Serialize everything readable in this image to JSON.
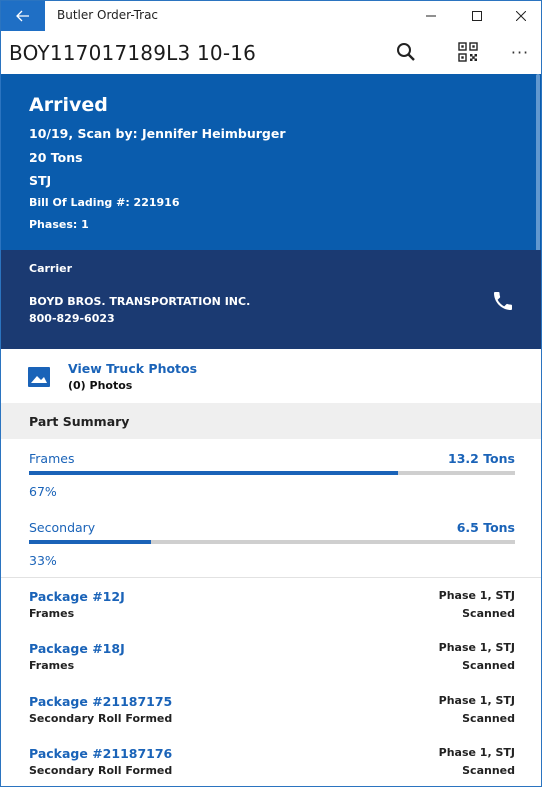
{
  "window": {
    "app_title": "Butler Order-Trac"
  },
  "header": {
    "title": "BOY117017189L3 10-16",
    "more_label": "···"
  },
  "status": {
    "state": "Arrived",
    "scan_line": "10/19, Scan by: Jennifer Heimburger",
    "weight": "20 Tons",
    "location": "STJ",
    "bill_of_lading": "Bill Of Lading #: 221916",
    "phases": "Phases: 1"
  },
  "carrier": {
    "label": "Carrier",
    "name": "BOYD BROS. TRANSPORTATION INC.",
    "phone": "800-829-6023"
  },
  "photos": {
    "link": "View Truck Photos",
    "count": "(0) Photos"
  },
  "summary": {
    "title": "Part Summary",
    "parts": [
      {
        "name": "Frames",
        "value": "13.2 Tons",
        "percent": "67%",
        "fraction": 0.76
      },
      {
        "name": "Secondary",
        "value": "6.5 Tons",
        "percent": "33%",
        "fraction": 0.25
      }
    ]
  },
  "packages": [
    {
      "name": "Package #12J",
      "type": "Frames",
      "phase": "Phase 1, STJ",
      "status": "Scanned"
    },
    {
      "name": "Package #18J",
      "type": "Frames",
      "phase": "Phase 1, STJ",
      "status": "Scanned"
    },
    {
      "name": "Package #21187175",
      "type": "Secondary Roll Formed",
      "phase": "Phase 1, STJ",
      "status": "Scanned"
    },
    {
      "name": "Package #21187176",
      "type": "Secondary Roll Formed",
      "phase": "Phase 1, STJ",
      "status": "Scanned"
    }
  ],
  "icons": {
    "back": "arrow-left-icon",
    "search": "search-icon",
    "qr": "qr-code-icon",
    "phone": "phone-icon",
    "photo": "image-icon"
  },
  "colors": {
    "accent": "#1a63b8",
    "status_bg": "#0a5cad",
    "carrier_bg": "#1b3a72",
    "summary_bg": "#efefef"
  }
}
